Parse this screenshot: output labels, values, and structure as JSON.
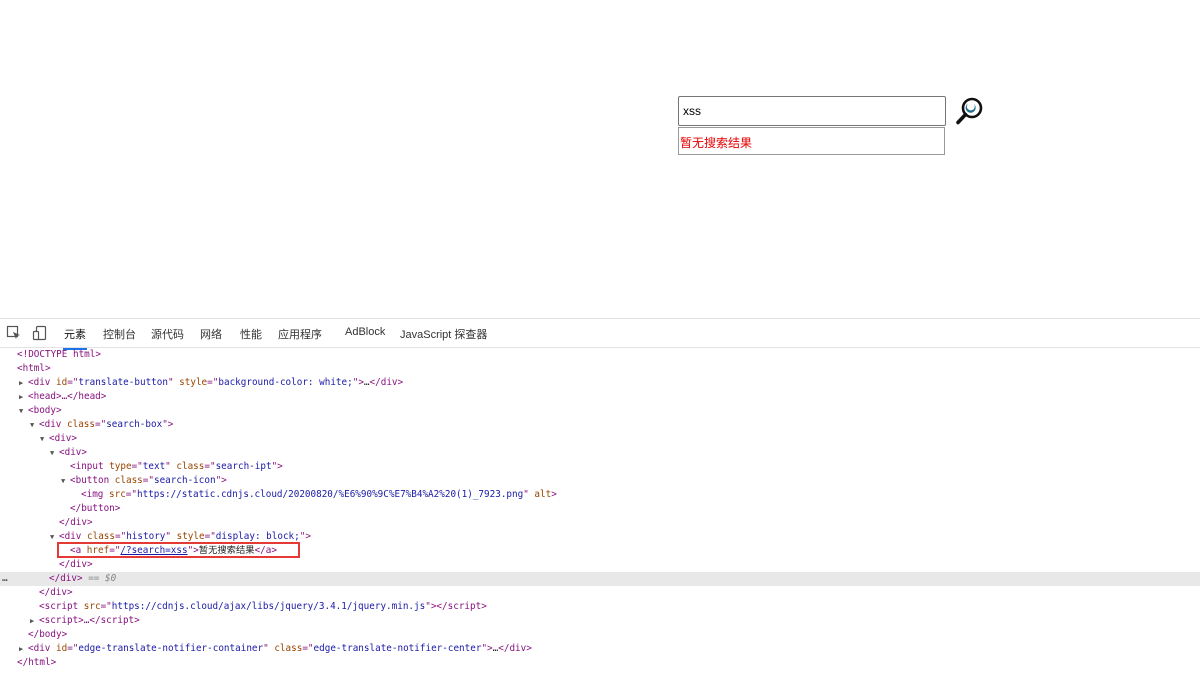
{
  "page": {
    "search": {
      "value": "xss",
      "button_label": "search"
    },
    "history": {
      "link_text": "暂无搜索结果"
    },
    "colors": {
      "result_text": "#e60000"
    }
  },
  "devtools": {
    "tabs": [
      "元素",
      "控制台",
      "源代码",
      "网络",
      "性能",
      "应用程序",
      "AdBlock",
      "JavaScript 探查器"
    ],
    "active_tab": "元素",
    "dom_lines": {
      "doctype": "<!DOCTYPE html>",
      "html_open": "<html>",
      "translate_div": {
        "id": "translate-button",
        "style": "background-color: white;"
      },
      "head": "<head>…</head>",
      "body_open": "<body>",
      "search_box_class": "search-box",
      "input_type": "text",
      "input_class": "search-ipt",
      "button_class": "search-icon",
      "img_src": "https://static.cdnjs.cloud/20200820/%E6%90%9C%E7%B4%A2%20(1)_7923.png",
      "history_class": "history",
      "history_style": "display: block;",
      "a_href": "/?search=xss",
      "a_text": "暂无搜索结果",
      "eq_dollar": "== $0",
      "script_src": "https://cdnjs.cloud/ajax/libs/jquery/3.4.1/jquery.min.js",
      "notifier_id": "edge-translate-notifier-container",
      "notifier_class": "edge-translate-notifier-center"
    }
  }
}
